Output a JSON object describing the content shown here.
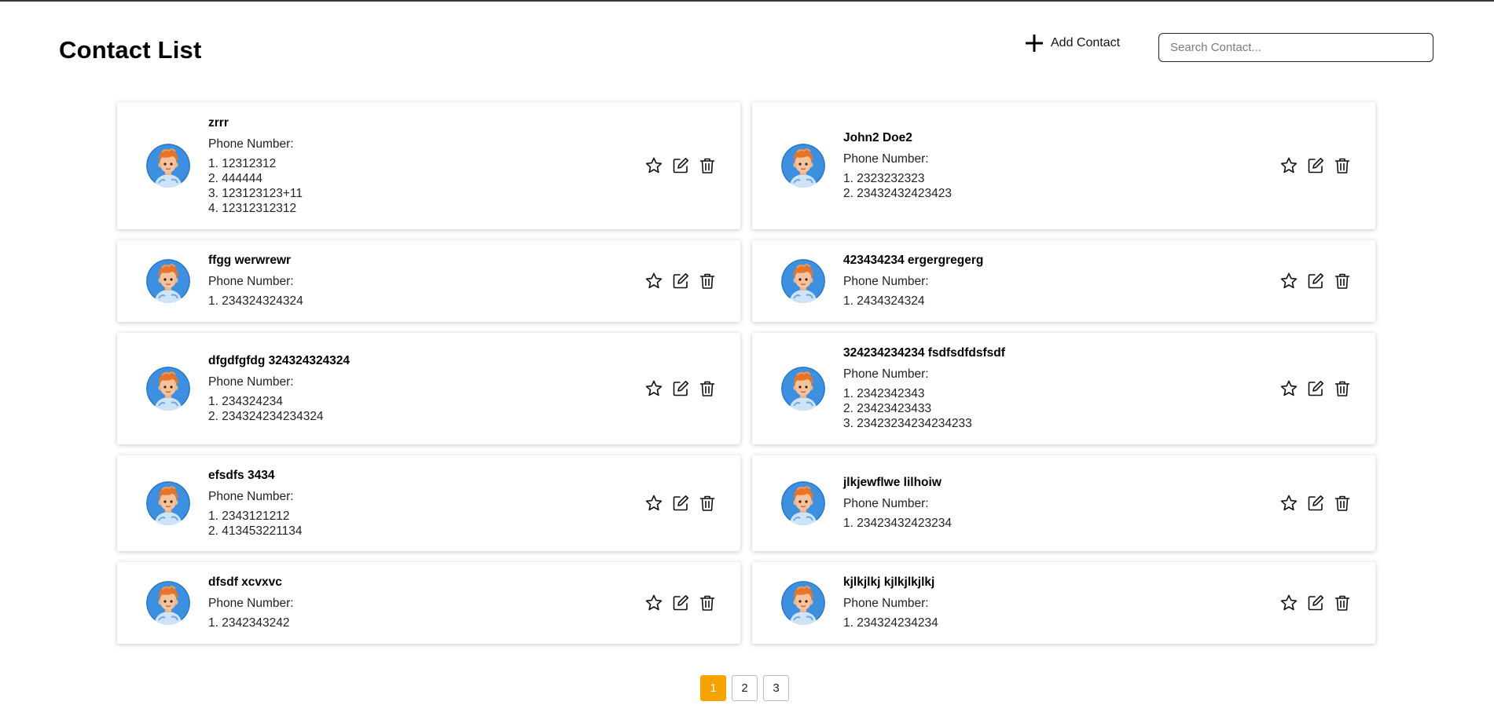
{
  "header": {
    "title": "Contact List",
    "add_label": "Add Contact",
    "search_placeholder": "Search Contact..."
  },
  "phone_label": "Phone Number:",
  "contacts": [
    {
      "name": "zrrr",
      "phones": [
        "12312312",
        "444444",
        "123123123+11",
        "12312312312"
      ]
    },
    {
      "name": "John2 Doe2",
      "phones": [
        "2323232323",
        "23432432423423"
      ]
    },
    {
      "name": "ffgg werwrewr",
      "phones": [
        "234324324324"
      ]
    },
    {
      "name": "423434234 ergergregerg",
      "phones": [
        "2434324324"
      ]
    },
    {
      "name": "dfgdfgfdg 324324324324",
      "phones": [
        "234324234",
        "234324234234324"
      ]
    },
    {
      "name": "324234234234 fsdfsdfdsfsdf",
      "phones": [
        "2342342343",
        "23423423433",
        "23423234234234233"
      ]
    },
    {
      "name": "efsdfs 3434",
      "phones": [
        "2343121212",
        "413453221134"
      ]
    },
    {
      "name": "jlkjewflwe lilhoiw",
      "phones": [
        "23423432423234"
      ]
    },
    {
      "name": "dfsdf xcvxvc",
      "phones": [
        "2342343242"
      ]
    },
    {
      "name": "kjlkjlkj kjlkjlkjlkj",
      "phones": [
        "234324234234"
      ]
    }
  ],
  "pagination": {
    "pages": [
      "1",
      "2",
      "3"
    ],
    "active": "1"
  },
  "colors": {
    "active_page": "#f5a300",
    "avatar_bg": "#3d8fe0"
  },
  "icons": {
    "add": "plus-icon",
    "favorite": "star-icon",
    "edit": "edit-icon",
    "delete": "trash-icon",
    "avatar": "avatar-icon"
  }
}
